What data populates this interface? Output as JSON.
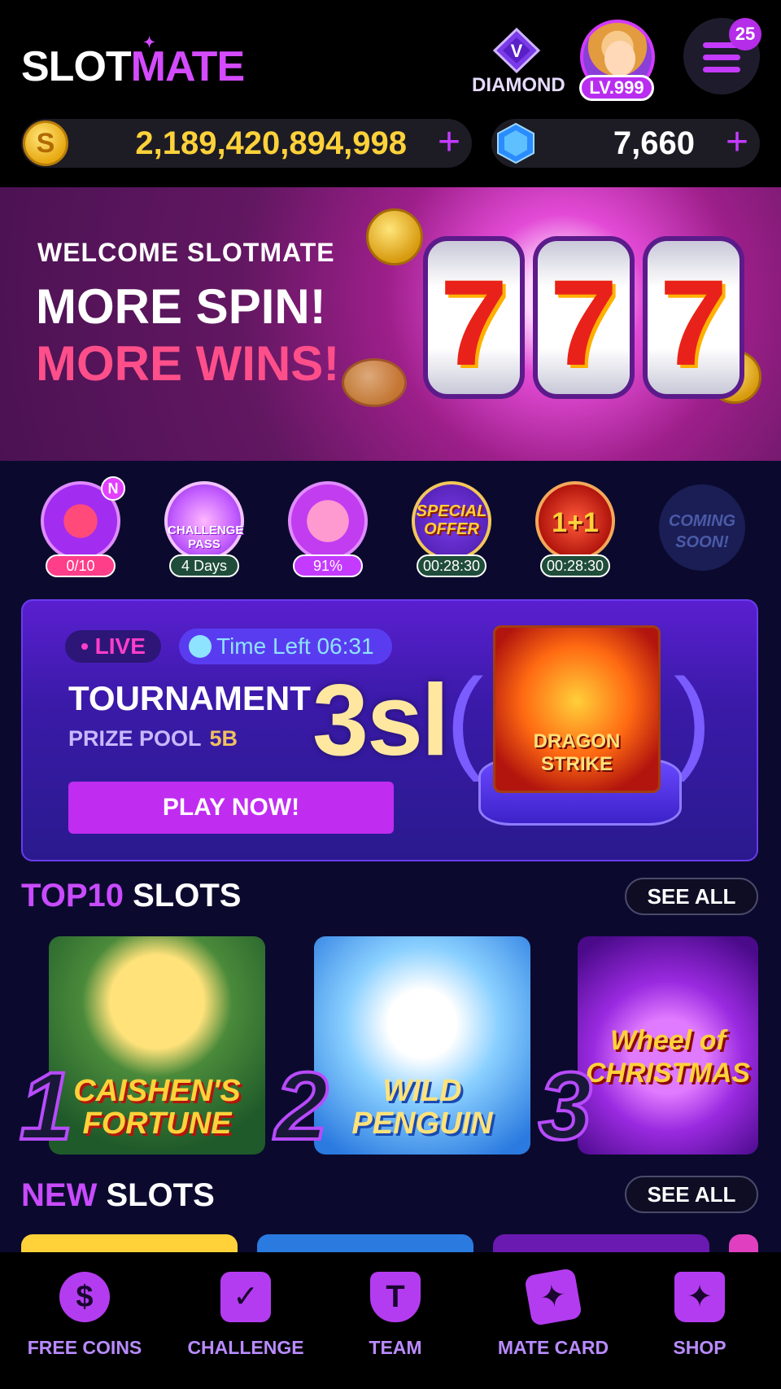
{
  "header": {
    "logo_part1": "SLOT",
    "logo_part2": "MATE",
    "rank_label": "DIAMOND",
    "level": "LV.999",
    "notifications": "25"
  },
  "currency": {
    "coins": "2,189,420,894,998",
    "gems": "7,660",
    "plus": "+"
  },
  "banner": {
    "welcome": "WELCOME  SLOTMATE",
    "line1": "MORE SPIN!",
    "line2": "MORE WINS!",
    "reel_digit": "7"
  },
  "quick_icons": [
    {
      "name": "tv-rewards",
      "tag": "0/10",
      "new_badge": "N",
      "tag_color": "#ff3e8a"
    },
    {
      "name": "challenge-pass",
      "label": "CHALLENGE PASS",
      "tag": "4 Days",
      "tag_color": "#1f4d3a"
    },
    {
      "name": "piggy-bank",
      "tag": "91%",
      "tag_color": "#c43bff"
    },
    {
      "name": "special-offer",
      "label": "SPECIAL OFFER",
      "tag": "00:28:30",
      "tag_color": "#1f4d3a"
    },
    {
      "name": "one-plus-one",
      "label": "1+1",
      "tag": "00:28:30",
      "tag_color": "#1f4d3a"
    }
  ],
  "coming_soon": "COMING SOON!",
  "tournament": {
    "live": "• LIVE",
    "time_left": "Time Left 06:31",
    "title": "TOURNAMENT",
    "prize_label": "PRIZE POOL",
    "prize_value": "5B",
    "overlay_text": "3sl",
    "play_button": "PLAY NOW!",
    "game_name": "DRAGON STRIKE"
  },
  "top10": {
    "title_hl": "TOP10",
    "title_rest": " SLOTS",
    "see_all": "SEE ALL",
    "games": [
      {
        "rank": "1",
        "name": "CAISHEN'S FORTUNE"
      },
      {
        "rank": "2",
        "name": "WILD PENGUIN"
      },
      {
        "rank": "3",
        "name": "Wheel of CHRISTMAS"
      }
    ]
  },
  "new_slots": {
    "title_hl": "NEW",
    "title_rest": " SLOTS",
    "see_all": "SEE ALL"
  },
  "bottom_nav": [
    {
      "label": "FREE COINS",
      "icon": "dollar-icon",
      "glyph": "$"
    },
    {
      "label": "CHALLENGE",
      "icon": "calendar-check-icon",
      "glyph": "✓"
    },
    {
      "label": "TEAM",
      "icon": "shield-t-icon",
      "glyph": "T"
    },
    {
      "label": "MATE CARD",
      "icon": "cards-icon",
      "glyph": "✦"
    },
    {
      "label": "SHOP",
      "icon": "shopping-bag-icon",
      "glyph": "✦"
    }
  ],
  "colors": {
    "accent": "#c43bff",
    "coin_gold": "#ffd23a",
    "background": "#0b0a2e"
  }
}
